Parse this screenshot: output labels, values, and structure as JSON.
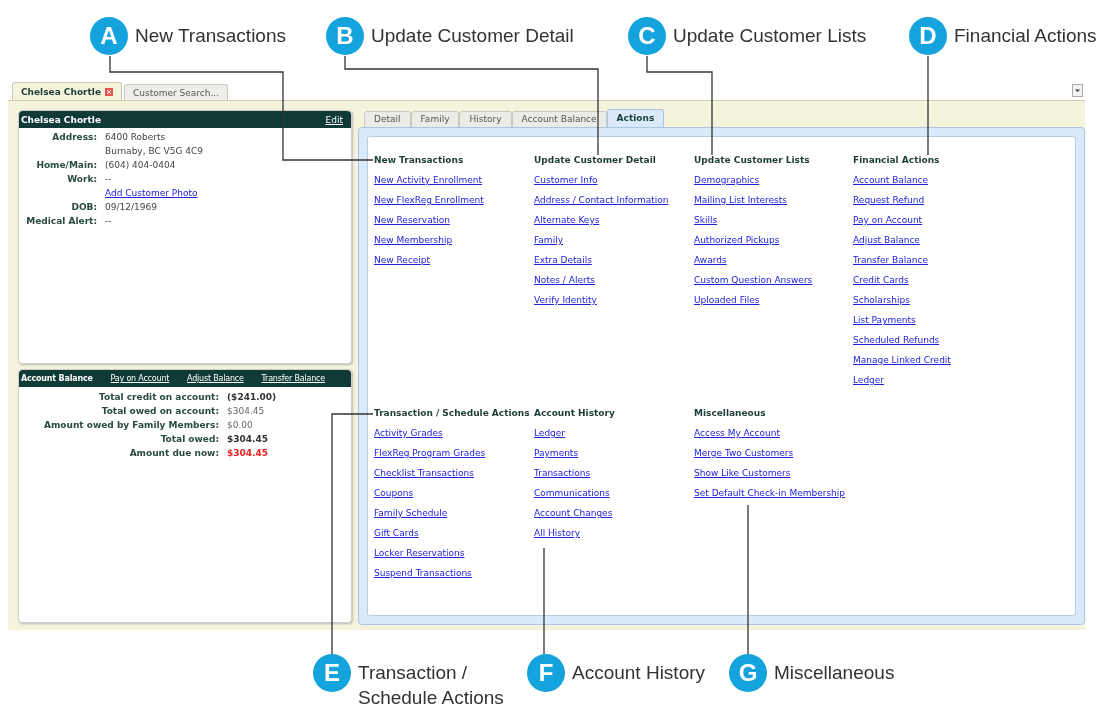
{
  "callouts_top": [
    {
      "letter": "A",
      "label": "New Transactions"
    },
    {
      "letter": "B",
      "label": "Update Customer Detail"
    },
    {
      "letter": "C",
      "label": "Update Customer Lists"
    },
    {
      "letter": "D",
      "label": "Financial Actions"
    }
  ],
  "callouts_bottom": [
    {
      "letter": "E",
      "label": "Transaction / Schedule Actions"
    },
    {
      "letter": "F",
      "label": "Account History"
    },
    {
      "letter": "G",
      "label": "Miscellaneous"
    }
  ],
  "customer_tabs": [
    {
      "label": "Chelsea Chortle",
      "selected": true,
      "closable": true
    },
    {
      "label": "Customer Search...",
      "selected": false,
      "closable": false
    }
  ],
  "customer_card": {
    "title": "Chelsea Chortle",
    "edit": "Edit",
    "fields": [
      {
        "kind": "text",
        "label": "Address:",
        "value": "6400 Roberts"
      },
      {
        "kind": "text",
        "value": "Burnaby, BC  V5G 4C9"
      },
      {
        "kind": "text",
        "label": "Home/Main:",
        "value": "(604) 404-0404"
      },
      {
        "kind": "text",
        "label": "Work:",
        "value": "--"
      },
      {
        "kind": "link",
        "value": "Add Customer Photo"
      },
      {
        "kind": "text",
        "label": "DOB:",
        "value": "09/12/1969"
      },
      {
        "kind": "text",
        "label": "Medical Alert:",
        "value": "--"
      }
    ]
  },
  "account_balance": {
    "title": "Account Balance",
    "links": [
      "Pay on Account",
      "Adjust Balance",
      "Transfer Balance"
    ],
    "rows": [
      {
        "label": "Total credit on account:",
        "value": "($241.00)",
        "kind": "bold"
      },
      {
        "label": "Total owed on account:",
        "value": "$304.45",
        "kind": "plain"
      },
      {
        "label": "Amount owed by Family Members:",
        "value": "$0.00",
        "kind": "plain"
      },
      {
        "label": "Total owed:",
        "value": "$304.45",
        "kind": "bold"
      },
      {
        "label": "Amount due now:",
        "value": "$304.45",
        "kind": "due"
      }
    ]
  },
  "detail_tabs": [
    {
      "label": "Detail",
      "selected": false
    },
    {
      "label": "Family",
      "selected": false
    },
    {
      "label": "History",
      "selected": false
    },
    {
      "label": "Account Balance",
      "selected": false
    },
    {
      "label": "Actions",
      "selected": true
    }
  ],
  "section_rows": [
    [
      {
        "heading": "New Transactions",
        "links": [
          "New Activity Enrollment",
          "New FlexReg Enrollment",
          "New Reservation",
          "New Membership",
          "New Receipt"
        ]
      },
      {
        "heading": "Update Customer Detail",
        "links": [
          "Customer Info",
          "Address / Contact Information",
          "Alternate Keys",
          "Family",
          "Extra Details",
          "Notes / Alerts",
          "Verify Identity"
        ]
      },
      {
        "heading": "Update Customer Lists",
        "links": [
          "Demographics",
          "Mailing List Interests",
          "Skills",
          "Authorized Pickups",
          "Awards",
          "Custom Question Answers",
          "Uploaded Files"
        ]
      },
      {
        "heading": "Financial Actions",
        "links": [
          "Account Balance",
          "Request Refund",
          "Pay on Account",
          "Adjust Balance",
          "Transfer Balance",
          "Credit Cards",
          "Scholarships",
          "List Payments",
          "Scheduled Refunds",
          "Manage Linked Credit",
          "Ledger"
        ]
      }
    ],
    [
      {
        "heading": "Transaction / Schedule Actions",
        "links": [
          "Activity Grades",
          "FlexReg Program Grades",
          "Checklist Transactions",
          "Coupons",
          "Family Schedule",
          "Gift Cards",
          "Locker Reservations",
          "Suspend Transactions"
        ]
      },
      {
        "heading": "Account History",
        "links": [
          "Ledger",
          "Payments",
          "Transactions",
          "Communications",
          "Account Changes",
          "All History"
        ]
      },
      {
        "heading": "Miscellaneous",
        "links": [
          "Access My Account",
          "Merge Two Customers",
          "Show Like Customers",
          "Set Default Check-in Membership"
        ]
      }
    ]
  ]
}
